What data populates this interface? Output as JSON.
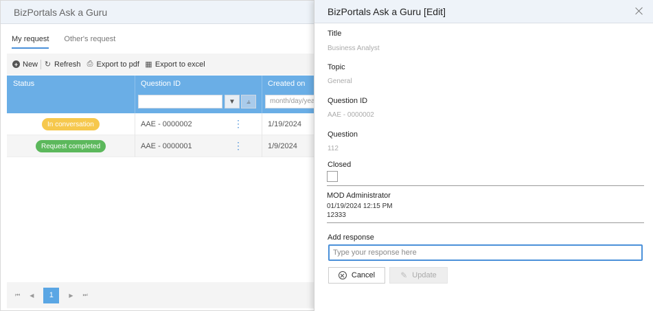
{
  "app": {
    "title": "BizPortals Ask a Guru",
    "tabs": [
      {
        "label": "My request"
      },
      {
        "label": "Other's request"
      }
    ],
    "toolbar": {
      "new_label": "New",
      "refresh_label": "Refresh",
      "export_pdf_label": "Export to pdf",
      "export_excel_label": "Export to excel"
    },
    "grid": {
      "columns": {
        "status": "Status",
        "question_id": "Question ID",
        "created_on": "Created on"
      },
      "date_placeholder": "month/day/yea",
      "rows": [
        {
          "status": "In conversation",
          "question_id": "AAE - 0000002",
          "created_on": "1/19/2024"
        },
        {
          "status": "Request completed",
          "question_id": "AAE - 0000001",
          "created_on": "1/9/2024"
        }
      ]
    },
    "pager": {
      "current_page": "1"
    }
  },
  "dialog": {
    "title": "BizPortals Ask a Guru [Edit]",
    "fields": {
      "title_label": "Title",
      "title_value": "Business Analyst",
      "topic_label": "Topic",
      "topic_value": "General",
      "qid_label": "Question ID",
      "qid_value": "AAE - 0000002",
      "question_label": "Question",
      "question_value": "112",
      "closed_label": "Closed"
    },
    "comment": {
      "author": "MOD Administrator",
      "timestamp": "01/19/2024 12:15 PM",
      "text": "12333"
    },
    "response": {
      "label": "Add response",
      "placeholder": "Type your response here"
    },
    "buttons": {
      "cancel_label": "Cancel",
      "update_label": "Update"
    }
  }
}
